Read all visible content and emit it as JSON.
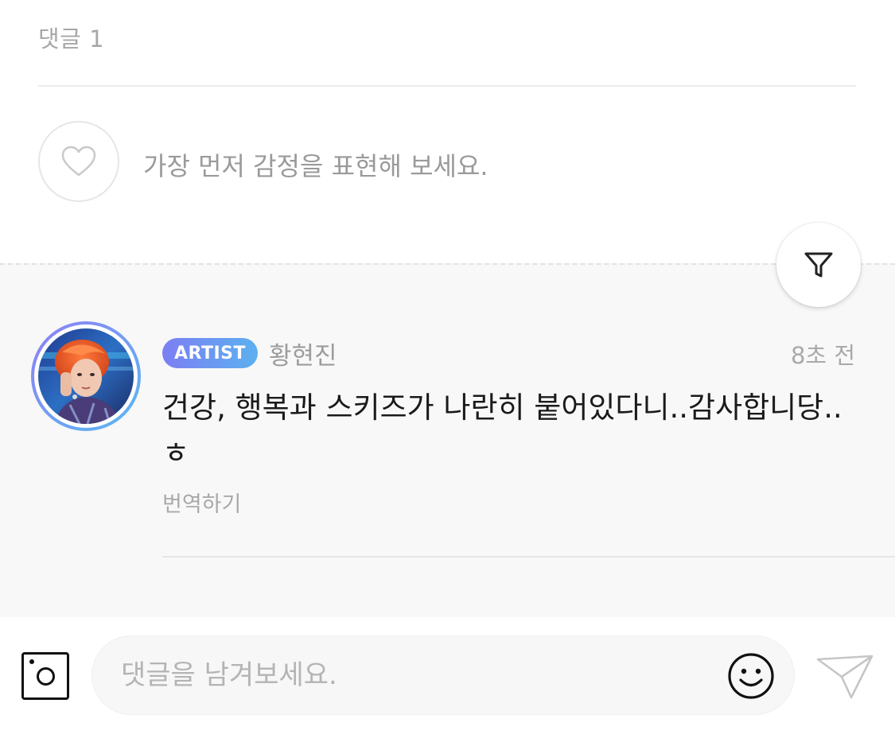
{
  "header": {
    "comment_count_label": "댓글 1"
  },
  "reaction": {
    "prompt": "가장 먼저 감정을 표현해 보세요.",
    "icon": "heart-outline-icon"
  },
  "filter": {
    "icon": "filter-funnel-icon"
  },
  "comments": [
    {
      "badge": "ARTIST",
      "author": "황현진",
      "time": "8초 전",
      "text": "건강, 행복과 스키즈가 나란히 붙어있다니..감사합니당..ㅎ",
      "translate_label": "번역하기"
    }
  ],
  "input_bar": {
    "placeholder": "댓글을 남겨보세요.",
    "camera_icon": "camera-icon",
    "emoji_icon": "smiley-face-icon",
    "send_icon": "paper-plane-send-icon"
  },
  "colors": {
    "badge_gradient_start": "#7c7ff2",
    "badge_gradient_end": "#5cb0f0",
    "section_bg": "#f8f8f8",
    "muted_text": "#a7a7a7"
  }
}
